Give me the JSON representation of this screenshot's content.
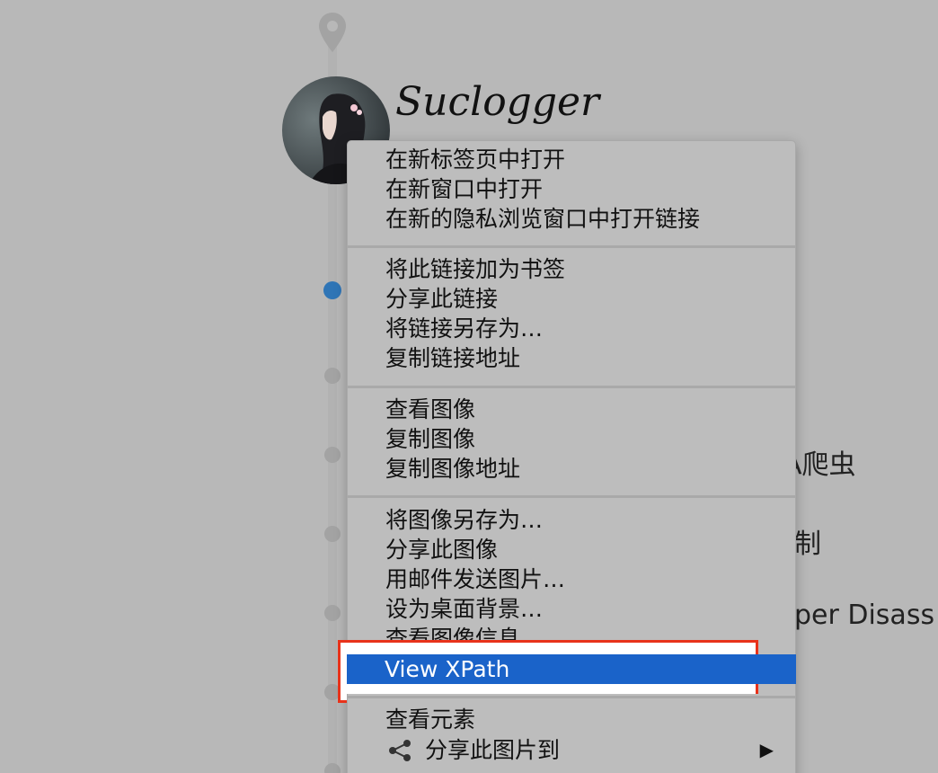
{
  "site": {
    "title": "Suclogger"
  },
  "background_posts": [
    {
      "text": "A爬虫"
    },
    {
      "text": "制"
    },
    {
      "text": "per Disass"
    }
  ],
  "context_menu": {
    "groups": [
      {
        "items": [
          {
            "label": "在新标签页中打开"
          },
          {
            "label": "在新窗口中打开"
          },
          {
            "label": "在新的隐私浏览窗口中打开链接"
          }
        ]
      },
      {
        "items": [
          {
            "label": "将此链接加为书签"
          },
          {
            "label": "分享此链接"
          },
          {
            "label": "将链接另存为…"
          },
          {
            "label": "复制链接地址"
          }
        ]
      },
      {
        "items": [
          {
            "label": "查看图像"
          },
          {
            "label": "复制图像"
          },
          {
            "label": "复制图像地址"
          }
        ]
      },
      {
        "items": [
          {
            "label": "将图像另存为…"
          },
          {
            "label": "分享此图像"
          },
          {
            "label": "用邮件发送图片…"
          },
          {
            "label": "设为桌面背景…"
          },
          {
            "label": "查看图像信息"
          },
          {
            "label": "View XPath",
            "highlighted": true
          }
        ]
      },
      {
        "items": [
          {
            "label": "查看元素"
          },
          {
            "label": "分享此图片到",
            "icon": "share-icon",
            "submenu": true
          }
        ]
      }
    ]
  },
  "colors": {
    "highlight": "#1a63c9",
    "annotation_border": "#e8321a",
    "timeline_active_dot": "#2f75b6"
  }
}
